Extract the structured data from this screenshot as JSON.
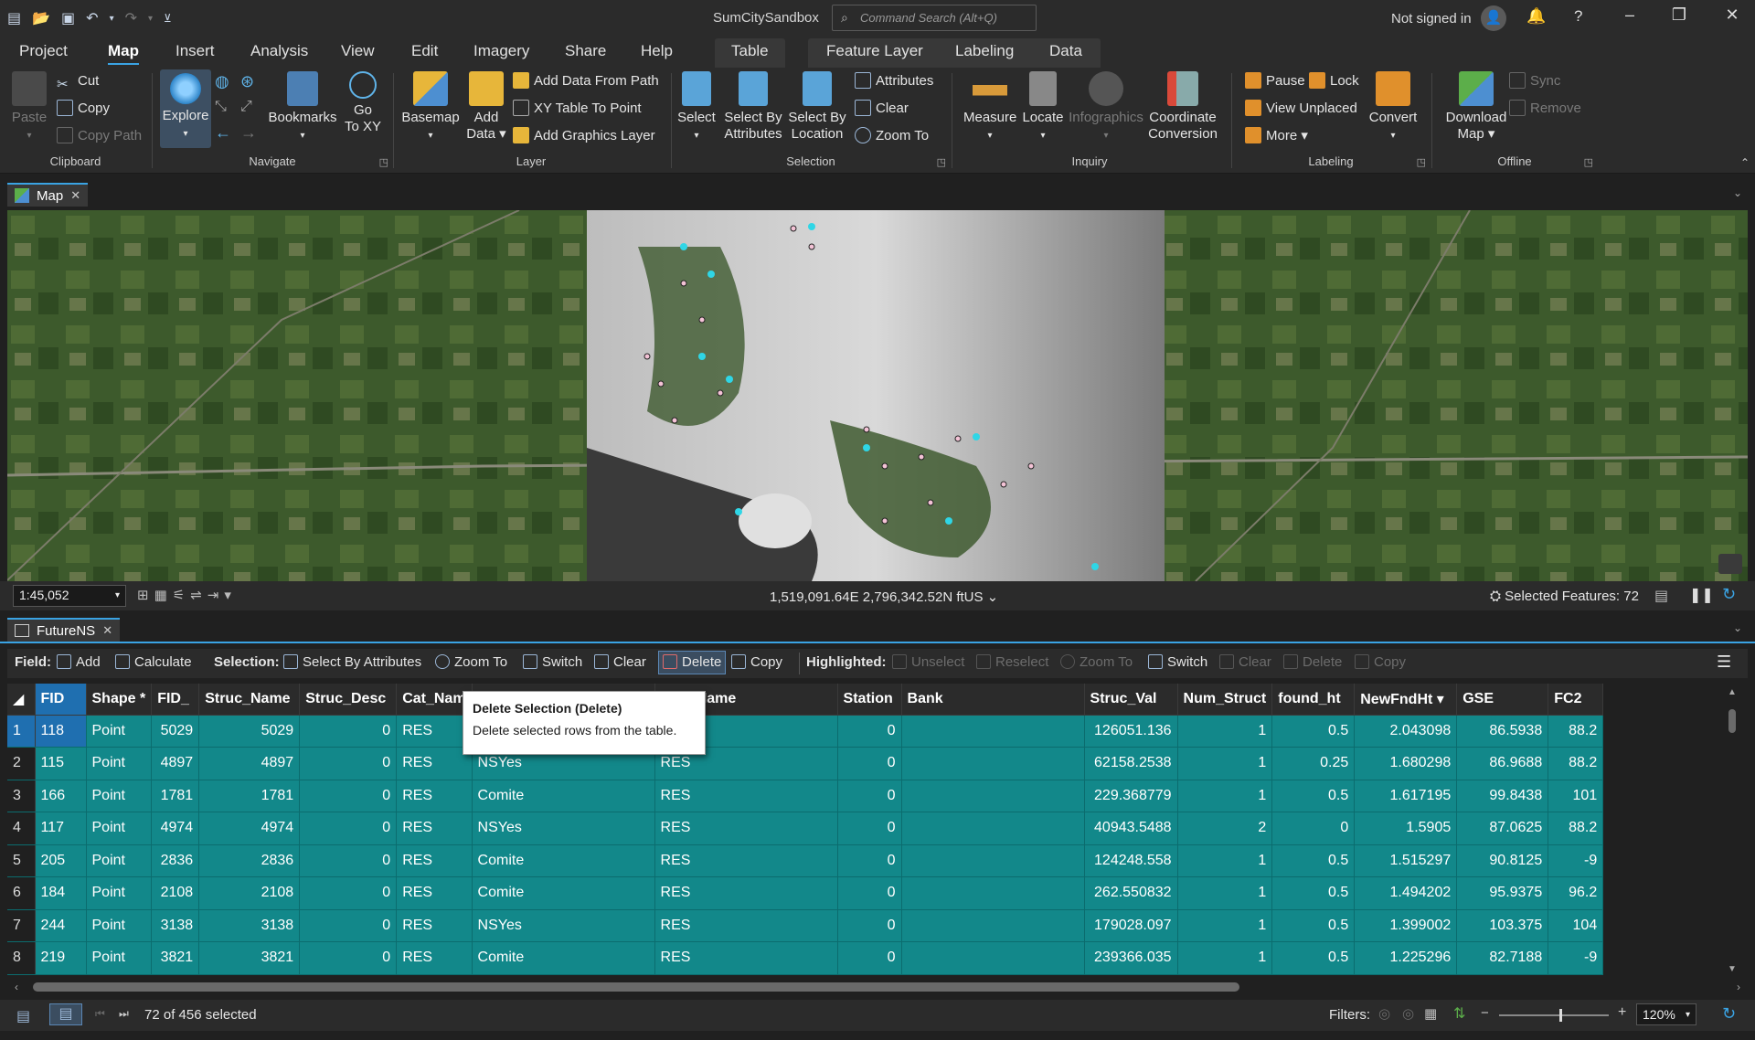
{
  "app": {
    "title": "SumCitySandbox",
    "search_placeholder": "Command Search (Alt+Q)",
    "signin": "Not signed in"
  },
  "menu_tabs": [
    "Project",
    "Map",
    "Insert",
    "Analysis",
    "View",
    "Edit",
    "Imagery",
    "Share",
    "Help"
  ],
  "active_tab": "Map",
  "context_tabs": {
    "table": "Table",
    "feature_layer": "Feature Layer",
    "labeling": "Labeling",
    "data": "Data"
  },
  "ribbon": {
    "clipboard": {
      "label": "Clipboard",
      "paste": "Paste",
      "cut": "Cut",
      "copy": "Copy",
      "copy_path": "Copy Path"
    },
    "navigate": {
      "label": "Navigate",
      "explore": "Explore",
      "bookmarks": "Bookmarks",
      "go_to_xy_1": "Go",
      "go_to_xy_2": "To XY"
    },
    "layer": {
      "label": "Layer",
      "basemap": "Basemap",
      "add_data_1": "Add",
      "add_data_2": "Data",
      "add_from_path": "Add Data From Path",
      "xy_table": "XY Table To Point",
      "graphics_layer": "Add Graphics Layer"
    },
    "selection": {
      "label": "Selection",
      "select": "Select",
      "sba_1": "Select By",
      "sba_2": "Attributes",
      "sbl_1": "Select By",
      "sbl_2": "Location",
      "attributes": "Attributes",
      "clear": "Clear",
      "zoom_to": "Zoom To"
    },
    "inquiry": {
      "label": "Inquiry",
      "measure": "Measure",
      "locate": "Locate",
      "infographics": "Infographics",
      "coord_1": "Coordinate",
      "coord_2": "Conversion"
    },
    "labeling": {
      "label": "Labeling",
      "pause": "Pause",
      "lock": "Lock",
      "view_unplaced": "View Unplaced",
      "more": "More",
      "convert": "Convert"
    },
    "offline": {
      "label": "Offline",
      "download_1": "Download",
      "download_2": "Map",
      "sync": "Sync",
      "remove": "Remove"
    }
  },
  "map_tab": "Map",
  "map_status": {
    "scale": "1:45,052",
    "coords": "1,519,091.64E 2,796,342.52N ftUS",
    "selected": "Selected Features: 72"
  },
  "table_tab": "FutureNS",
  "table_toolbar": {
    "field_label": "Field:",
    "add": "Add",
    "calculate": "Calculate",
    "selection_label": "Selection:",
    "select_by_attributes": "Select By Attributes",
    "zoom_to": "Zoom To",
    "switch": "Switch",
    "clear": "Clear",
    "delete": "Delete",
    "copy": "Copy",
    "highlighted_label": "Highlighted:",
    "unselect": "Unselect",
    "reselect": "Reselect",
    "h_zoom_to": "Zoom To",
    "h_switch": "Switch",
    "h_clear": "Clear",
    "h_delete": "Delete",
    "h_copy": "Copy"
  },
  "columns": [
    "FID",
    "Shape *",
    "FID_",
    "Struc_Name",
    "Struc_Desc",
    "Cat_Nam",
    "",
    "Occ_Name",
    "Station",
    "Bank",
    "Struc_Val",
    "Num_Struct",
    "found_ht",
    "NewFndHt ▾",
    "GSE",
    "FC2"
  ],
  "rows": [
    [
      "1",
      "118",
      "Point",
      "5029",
      "5029",
      "0",
      "RES",
      "",
      "RES",
      "0",
      "",
      "126051.136",
      "1",
      "0.5",
      "2.043098",
      "86.5938",
      "88.2"
    ],
    [
      "2",
      "115",
      "Point",
      "4897",
      "4897",
      "0",
      "RES",
      "NSYes",
      "RES",
      "0",
      "",
      "62158.2538",
      "1",
      "0.25",
      "1.680298",
      "86.9688",
      "88.2"
    ],
    [
      "3",
      "166",
      "Point",
      "1781",
      "1781",
      "0",
      "RES",
      "Comite",
      "RES",
      "0",
      "",
      "229.368779",
      "1",
      "0.5",
      "1.617195",
      "99.8438",
      "101"
    ],
    [
      "4",
      "117",
      "Point",
      "4974",
      "4974",
      "0",
      "RES",
      "NSYes",
      "RES",
      "0",
      "",
      "40943.5488",
      "2",
      "0",
      "1.5905",
      "87.0625",
      "88.2"
    ],
    [
      "5",
      "205",
      "Point",
      "2836",
      "2836",
      "0",
      "RES",
      "Comite",
      "RES",
      "0",
      "",
      "124248.558",
      "1",
      "0.5",
      "1.515297",
      "90.8125",
      "-9"
    ],
    [
      "6",
      "184",
      "Point",
      "2108",
      "2108",
      "0",
      "RES",
      "Comite",
      "RES",
      "0",
      "",
      "262.550832",
      "1",
      "0.5",
      "1.494202",
      "95.9375",
      "96.2"
    ],
    [
      "7",
      "244",
      "Point",
      "3138",
      "3138",
      "0",
      "RES",
      "NSYes",
      "RES",
      "0",
      "",
      "179028.097",
      "1",
      "0.5",
      "1.399002",
      "103.375",
      "104"
    ],
    [
      "8",
      "219",
      "Point",
      "3821",
      "3821",
      "0",
      "RES",
      "Comite",
      "RES",
      "0",
      "",
      "239366.035",
      "1",
      "0.5",
      "1.225296",
      "82.7188",
      "-9"
    ]
  ],
  "tooltip": {
    "title": "Delete Selection (Delete)",
    "body": "Delete selected rows from the table."
  },
  "table_status": {
    "selected": "72 of 456 selected",
    "filters": "Filters:",
    "zoom": "120%"
  },
  "colors": {
    "accent": "#3aa3e3",
    "selected_row": "#12888a",
    "ribbon_bg": "#2b2b2b"
  }
}
